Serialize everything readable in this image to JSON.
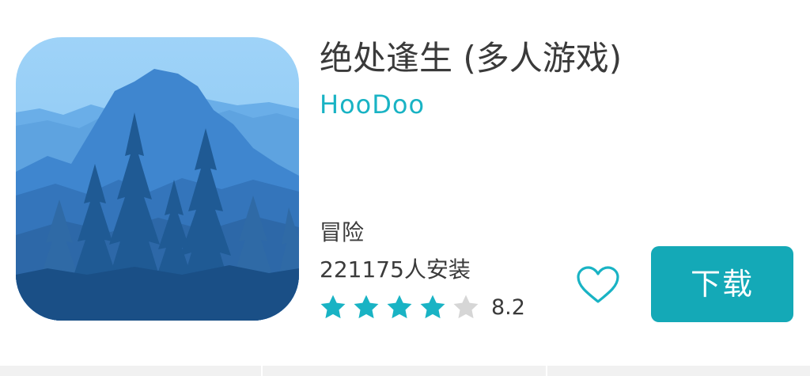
{
  "app": {
    "title": "绝处逢生 (多人游戏)",
    "developer": "HooDoo",
    "category": "冒险",
    "installs": "221175人安装",
    "rating": {
      "value": "8.2",
      "stars_filled": 4,
      "stars_total": 5
    },
    "icon": "mountain-forest-app-icon"
  },
  "actions": {
    "favorite_icon": "heart-outline-icon",
    "download_label": "下载"
  },
  "colors": {
    "accent": "#14a9b7",
    "developer_text": "#19b3c4",
    "star_filled": "#19b3c4",
    "star_empty": "#d6d6d6",
    "text": "#3a3a3a"
  }
}
